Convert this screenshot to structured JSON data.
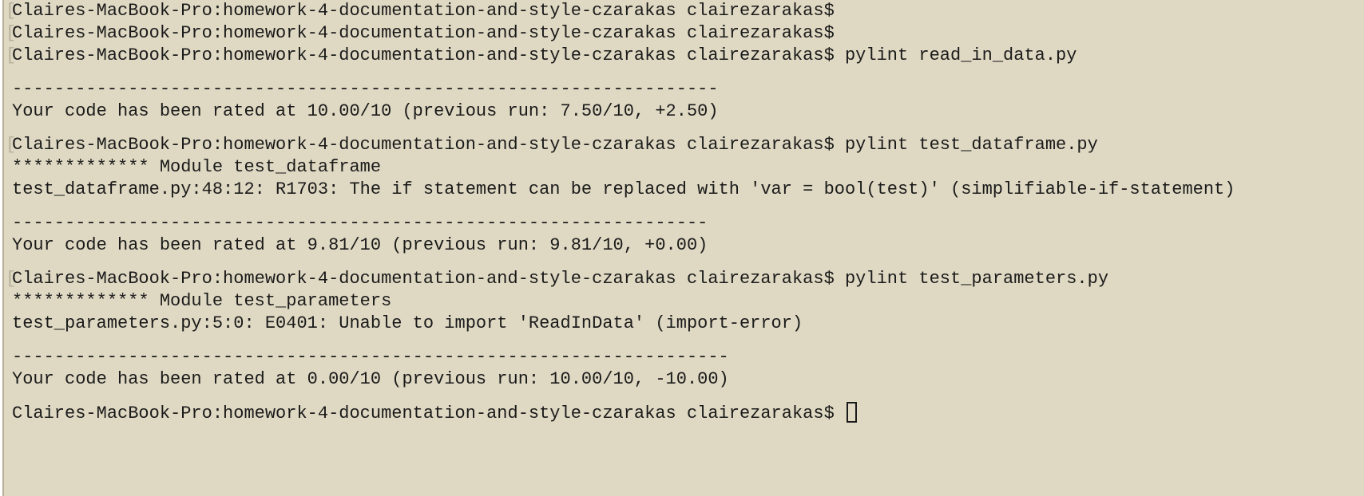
{
  "terminal": {
    "lines": [
      {
        "kind": "prompt",
        "bracket": true,
        "prompt": "Claires-MacBook-Pro:homework-4-documentation-and-style-czarakas clairezarakas$",
        "command": ""
      },
      {
        "kind": "prompt",
        "bracket": true,
        "prompt": "Claires-MacBook-Pro:homework-4-documentation-and-style-czarakas clairezarakas$",
        "command": ""
      },
      {
        "kind": "prompt",
        "bracket": true,
        "prompt": "Claires-MacBook-Pro:homework-4-documentation-and-style-czarakas clairezarakas$",
        "command": " pylint read_in_data.py"
      },
      {
        "kind": "blank"
      },
      {
        "kind": "text",
        "text": "-------------------------------------------------------------------"
      },
      {
        "kind": "text",
        "text": "Your code has been rated at 10.00/10 (previous run: 7.50/10, +2.50)"
      },
      {
        "kind": "blank"
      },
      {
        "kind": "prompt",
        "bracket": true,
        "prompt": "Claires-MacBook-Pro:homework-4-documentation-and-style-czarakas clairezarakas$",
        "command": " pylint test_dataframe.py"
      },
      {
        "kind": "text",
        "text": "************* Module test_dataframe"
      },
      {
        "kind": "text",
        "text": "test_dataframe.py:48:12: R1703: The if statement can be replaced with 'var = bool(test)' (simplifiable-if-statement)"
      },
      {
        "kind": "blank"
      },
      {
        "kind": "text",
        "text": "------------------------------------------------------------------"
      },
      {
        "kind": "text",
        "text": "Your code has been rated at 9.81/10 (previous run: 9.81/10, +0.00)"
      },
      {
        "kind": "blank"
      },
      {
        "kind": "prompt",
        "bracket": true,
        "prompt": "Claires-MacBook-Pro:homework-4-documentation-and-style-czarakas clairezarakas$",
        "command": " pylint test_parameters.py"
      },
      {
        "kind": "text",
        "text": "************* Module test_parameters"
      },
      {
        "kind": "text",
        "text": "test_parameters.py:5:0: E0401: Unable to import 'ReadInData' (import-error)"
      },
      {
        "kind": "blank"
      },
      {
        "kind": "text",
        "text": "--------------------------------------------------------------------"
      },
      {
        "kind": "text",
        "text": "Your code has been rated at 0.00/10 (previous run: 10.00/10, -10.00)"
      },
      {
        "kind": "blank"
      },
      {
        "kind": "prompt",
        "bracket": false,
        "prompt": "Claires-MacBook-Pro:homework-4-documentation-and-style-czarakas clairezarakas$",
        "command": " ",
        "cursor": true
      }
    ]
  },
  "colors": {
    "background": "#dfd9c3",
    "text": "#1a1a1a",
    "bracket": "#b7b09a"
  }
}
